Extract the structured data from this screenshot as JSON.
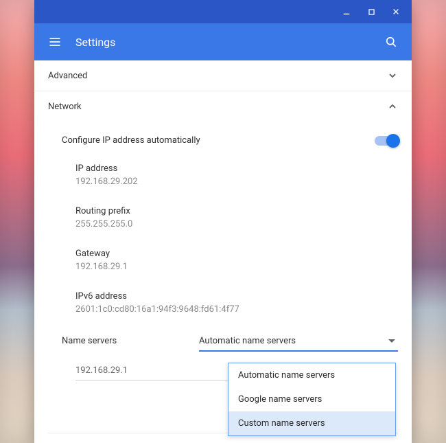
{
  "app": {
    "title": "Settings"
  },
  "sections": {
    "advanced": {
      "label": "Advanced"
    },
    "network": {
      "label": "Network"
    }
  },
  "network": {
    "auto_ip": {
      "label": "Configure IP address automatically",
      "enabled": true
    },
    "fields": {
      "ip": {
        "label": "IP address",
        "value": "192.168.29.202"
      },
      "prefix": {
        "label": "Routing prefix",
        "value": "255.255.255.0"
      },
      "gateway": {
        "label": "Gateway",
        "value": "192.168.29.1"
      },
      "ipv6": {
        "label": "IPv6 address",
        "value": "2601:1c0:cd80:16a1:94f3:9648:fd61:4f77"
      }
    },
    "name_servers": {
      "label": "Name servers",
      "selected": "Automatic name servers",
      "options": [
        "Automatic name servers",
        "Google name servers",
        "Custom name servers"
      ],
      "highlighted_index": 2,
      "address": "192.168.29.1"
    }
  },
  "colors": {
    "titlebar": "#2a56c6",
    "appbar": "#3b78e7",
    "accent": "#1a73e8"
  }
}
